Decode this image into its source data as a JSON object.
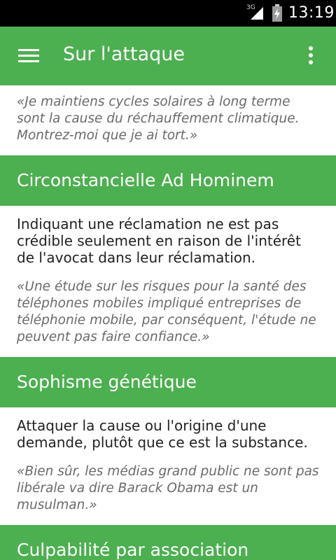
{
  "status_bar": {
    "network": "3G",
    "time": "13:19"
  },
  "app_bar": {
    "title": "Sur l'attaque",
    "menu_icon": "hamburger-menu-icon",
    "overflow_icon": "more-vert-icon"
  },
  "intro_example": "«Je maintiens cycles solaires à long terme sont la cause du réchauffement climatique. Montrez-moi que je ai tort.»",
  "sections": [
    {
      "title": "Circonstancielle Ad Hominem",
      "definition": "Indiquant une réclamation ne est pas crédible seulement en raison de l'intérêt de l'avocat dans leur réclamation.",
      "example": "«Une étude sur les risques pour la santé des téléphones mobiles impliqué entreprises de téléphonie mobile, par conséquent, l'étude ne peuvent pas faire confiance.»"
    },
    {
      "title": "Sophisme génétique",
      "definition": "Attaquer la cause ou l'origine d'une demande, plutôt que ce est la substance.",
      "example": "«Bien sûr, les médias grand public ne sont pas libérale va dire Barack Obama est un musulman.»"
    },
    {
      "title": "Culpabilité par association"
    }
  ],
  "colors": {
    "primary": "#4caf50",
    "status_bar": "#000000",
    "example_text": "#6a6a6a",
    "body_text": "#222222"
  }
}
